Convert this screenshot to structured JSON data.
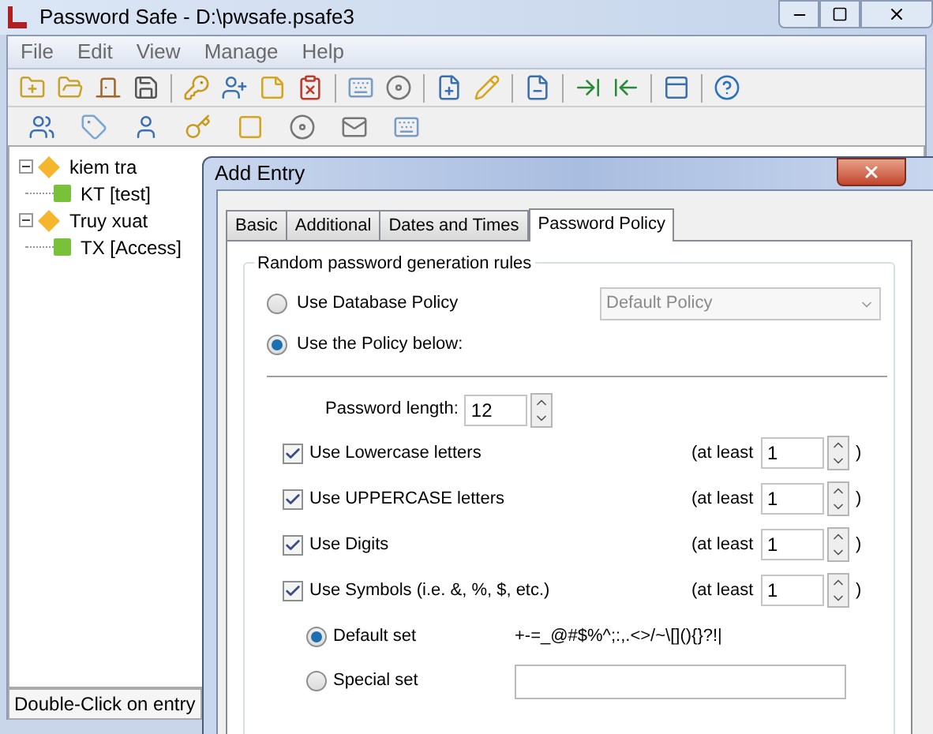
{
  "window": {
    "title": "Password Safe - D:\\pwsafe.psafe3"
  },
  "menu": [
    "File",
    "Edit",
    "View",
    "Manage",
    "Help"
  ],
  "tree": [
    {
      "label": "kiem tra",
      "expanded": true,
      "children": [
        {
          "label": "KT [test]"
        }
      ]
    },
    {
      "label": "Truy xuat",
      "expanded": true,
      "children": [
        {
          "label": "TX [Access]"
        }
      ]
    }
  ],
  "status_bar": "Double-Click on entry",
  "dialog": {
    "title": "Add Entry",
    "tabs": [
      {
        "label": "Basic",
        "selected": false
      },
      {
        "label": "Additional",
        "selected": false
      },
      {
        "label": "Dates and Times",
        "selected": false
      },
      {
        "label": "Password Policy",
        "selected": true
      }
    ],
    "group_title": "Random password generation rules",
    "policy_options": [
      {
        "label": "Use Database Policy",
        "selected": false
      },
      {
        "label": "Use the Policy below:",
        "selected": true
      }
    ],
    "policy_dropdown": {
      "value": "Default Policy",
      "disabled": true
    },
    "password_length": {
      "label": "Password length:",
      "value": "12"
    },
    "rules": [
      {
        "label": "Use Lowercase letters",
        "checked": true,
        "at_least": "(at least",
        "value": "1",
        "close": ")"
      },
      {
        "label": "Use UPPERCASE letters",
        "checked": true,
        "at_least": "(at least",
        "value": "1",
        "close": ")"
      },
      {
        "label": "Use Digits",
        "checked": true,
        "at_least": "(at least",
        "value": "1",
        "close": ")"
      },
      {
        "label": "Use Symbols (i.e. &, %, $, etc.)",
        "checked": true,
        "at_least": "(at least",
        "value": "1",
        "close": ")"
      }
    ],
    "symbol_sets": [
      {
        "label": "Default set",
        "selected": true,
        "symbols": "+-=_@#$%^;:,.<>/~\\[](){}?!|"
      },
      {
        "label": "Special set",
        "selected": false
      }
    ]
  }
}
